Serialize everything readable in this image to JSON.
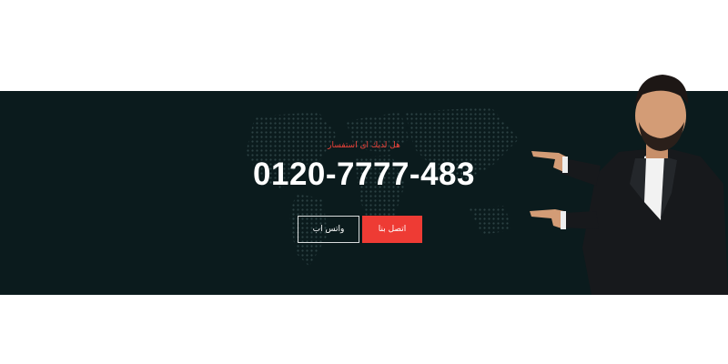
{
  "cta": {
    "question": "هل لديك اى استفسار",
    "phone": "0120-7777-483",
    "whatsapp_label": "واتس اب",
    "contact_label": "اتصل بنا"
  },
  "colors": {
    "banner_bg": "#0b1b1d",
    "accent": "#ee3b34",
    "text": "#ffffff"
  },
  "icons": {
    "background": "world-map-dots",
    "illustration": "businessman-pointing"
  }
}
